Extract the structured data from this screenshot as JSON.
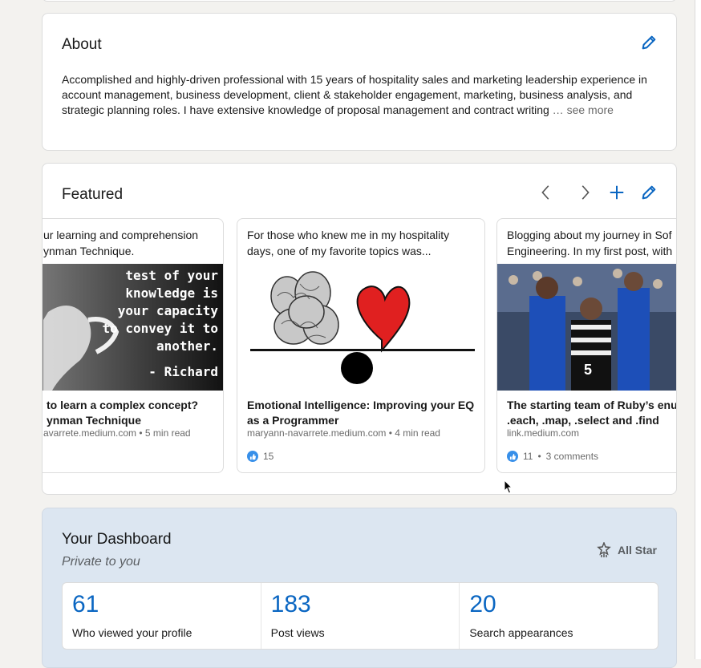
{
  "about": {
    "title": "About",
    "text": "Accomplished and highly-driven professional with 15 years of hospitality sales and marketing leadership experience in account management, business development, client & stakeholder engagement, marketing, business analysis, and strategic planning roles. I have extensive knowledge of proposal management and contract writing",
    "ellipsis": " …",
    "see_more": " see more",
    "icons": [
      "pencil-icon"
    ]
  },
  "featured": {
    "title": "Featured",
    "icons": [
      "chevron-left-icon",
      "chevron-right-icon",
      "plus-icon",
      "pencil-icon"
    ],
    "items": [
      {
        "description": "ur learning and comprehension\nynman Technique.",
        "image_text": [
          "test of your",
          "knowledge is",
          "your capacity",
          "to convey it to",
          "another.",
          "- Richard"
        ],
        "title": "to learn a complex concept?\nynman Technique",
        "meta": "avarrete.medium.com • 5 min read"
      },
      {
        "description": "For those who knew me in my hospitality\ndays, one of my favorite topics was...",
        "title": "Emotional Intelligence: Improving your EQ\nas a Programmer",
        "meta": "maryann-navarrete.medium.com • 4 min read",
        "reactions": "15"
      },
      {
        "description": "Blogging about my journey in Sof\nEngineering. In my first post, with",
        "title": "The starting team of Ruby’s enu\n.each, .map, .select and .find",
        "meta": "link.medium.com",
        "reactions": "11",
        "comments": "3 comments"
      }
    ]
  },
  "dashboard": {
    "title": "Your Dashboard",
    "subtitle": "Private to you",
    "badge": "All Star",
    "stats": [
      {
        "value": "61",
        "label": "Who viewed your profile"
      },
      {
        "value": "183",
        "label": "Post views"
      },
      {
        "value": "20",
        "label": "Search appearances"
      }
    ]
  },
  "colors": {
    "accent": "#0a66c2",
    "dashboard_bg": "#dce6f1",
    "like": "#378fe9"
  }
}
